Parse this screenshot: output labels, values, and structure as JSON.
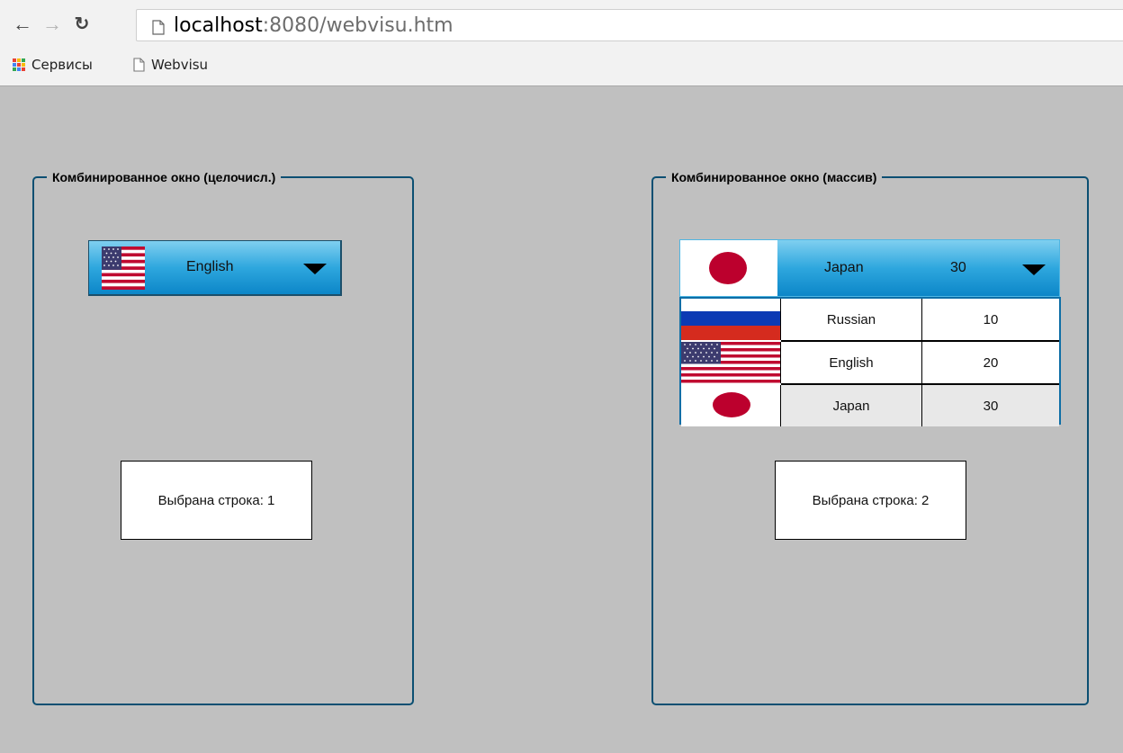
{
  "browser": {
    "url_host": "localhost",
    "url_rest": ":8080/webvisu.htm",
    "bookmarks": [
      {
        "label": "Сервисы",
        "icon": "apps-grid-icon"
      },
      {
        "label": "Webvisu",
        "icon": "page-icon"
      }
    ],
    "nav_icons": {
      "back": "back-arrow-icon",
      "forward": "forward-arrow-icon",
      "reload": "reload-icon"
    }
  },
  "left_group": {
    "title": "Комбинированное окно (целочисл.)",
    "combo": {
      "flag": "us-flag-icon",
      "selected_label": "English",
      "open": false
    },
    "status": "Выбрана строка: 1"
  },
  "right_group": {
    "title": "Комбинированное окно (массив)",
    "combo": {
      "flag": "japan-flag-icon",
      "selected_label": "Japan",
      "selected_value": "30",
      "open": true
    },
    "options": [
      {
        "flag": "russia-flag-icon",
        "label": "Russian",
        "value": "10",
        "selected": false
      },
      {
        "flag": "us-flag-icon",
        "label": "English",
        "value": "20",
        "selected": false
      },
      {
        "flag": "japan-flag-icon",
        "label": "Japan",
        "value": "30",
        "selected": true
      }
    ],
    "status": "Выбрана строка: 2"
  },
  "colors": {
    "background": "#c0c0c0",
    "group_border": "#0b4f72",
    "combo_gradient_top": "#7fcff0",
    "combo_gradient_bottom": "#0c86c8",
    "japan_red": "#bc002d",
    "selected_row": "#e8e8e8"
  }
}
